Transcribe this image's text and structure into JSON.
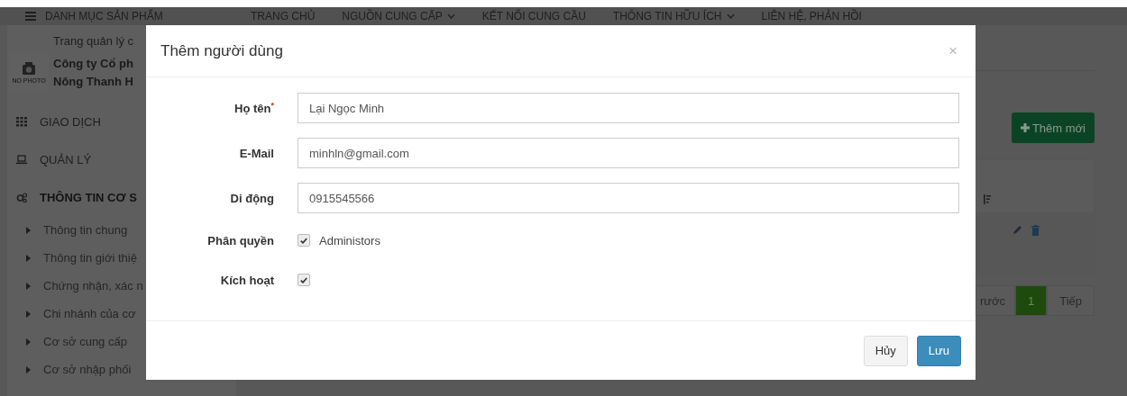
{
  "nav": {
    "menu_label": "DANH MỤC SẢN PHẨM",
    "items": [
      {
        "label": "TRANG CHỦ",
        "dropdown": false
      },
      {
        "label": "NGUỒN CUNG CẤP",
        "dropdown": true
      },
      {
        "label": "KẾT NỐI CUNG CẦU",
        "dropdown": false
      },
      {
        "label": "THÔNG TIN HỮU ÍCH",
        "dropdown": true
      },
      {
        "label": "LIÊN HỆ, PHẢN HỒI",
        "dropdown": false
      }
    ]
  },
  "sidebar": {
    "photo_label": "NO PHOTO",
    "page_title": "Trang quản lý c",
    "company": [
      "Công ty Cổ ph",
      "Nông Thanh H"
    ],
    "menu": [
      {
        "label": "GIAO DỊCH",
        "kind": "grid",
        "expanded": false
      },
      {
        "label": "QUẢN LÝ",
        "kind": "laptop",
        "expanded": false
      },
      {
        "label": "THÔNG TIN CƠ S",
        "kind": "gears",
        "expanded": true,
        "children": [
          {
            "label": "Thông tin chung"
          },
          {
            "label": "Thông tin giới thiệ"
          },
          {
            "label": "Chứng nhận, xác n"
          },
          {
            "label": "Chi nhánh của cơ"
          },
          {
            "label": "Cơ sở cung cấp"
          },
          {
            "label": "Cơ sở nhập phối"
          }
        ]
      }
    ]
  },
  "main": {
    "add_button": "Thêm mới",
    "pagination": [
      {
        "label": "rước",
        "selected": false
      },
      {
        "label": "1",
        "selected": true
      },
      {
        "label": "Tiếp",
        "selected": false
      }
    ]
  },
  "dialog": {
    "title": "Thêm người dùng",
    "close": "×",
    "fields": [
      {
        "kind": "text",
        "label": "Họ tên",
        "required_mark": "*",
        "value": "Lại Ngọc Minh"
      },
      {
        "kind": "text",
        "label": "E-Mail",
        "value": "minhln@gmail.com"
      },
      {
        "kind": "text",
        "label": "Di động",
        "value": "0915545566"
      },
      {
        "kind": "checkbox",
        "label": "Phân quyền",
        "option": "Administors",
        "checked": true
      },
      {
        "kind": "checkbox",
        "label": "Kích hoạt",
        "checked": true
      }
    ],
    "buttons": [
      {
        "label": "Hủy",
        "kind": "default"
      },
      {
        "label": "Lưu",
        "kind": "primary"
      }
    ]
  }
}
